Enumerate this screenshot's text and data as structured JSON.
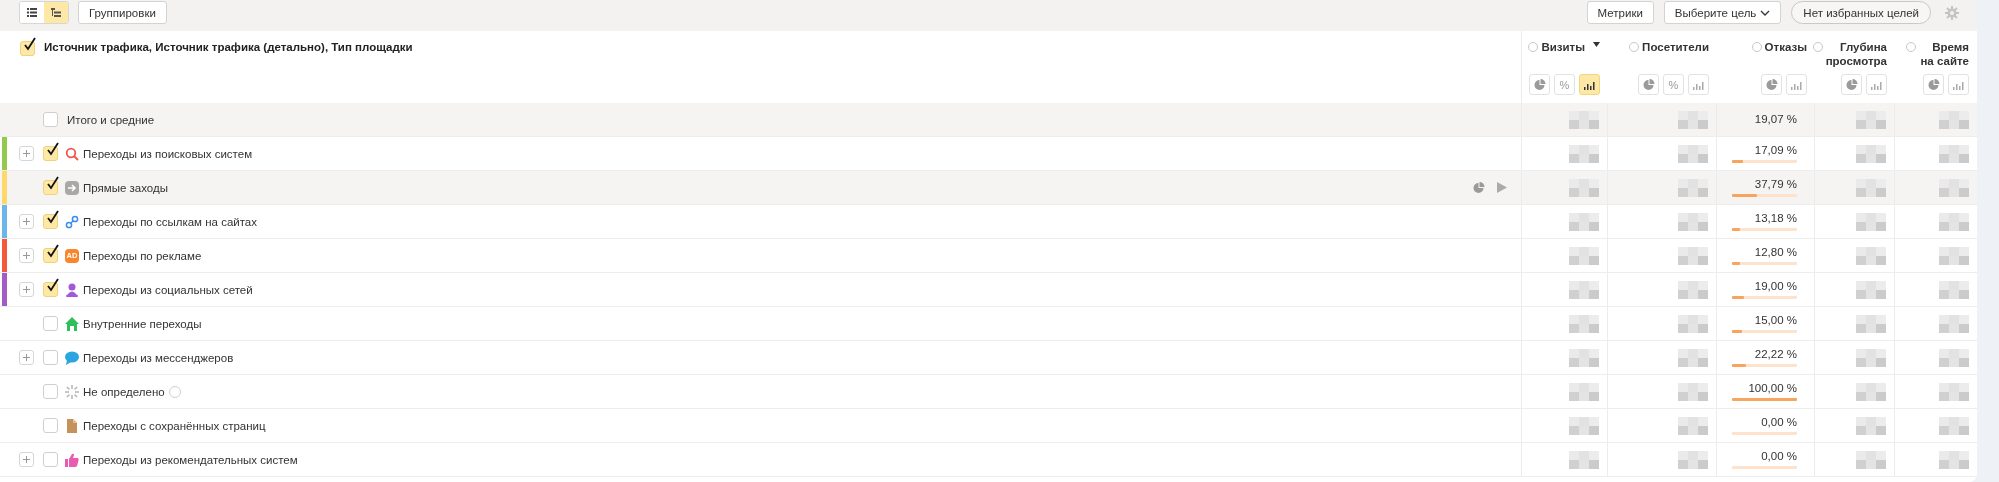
{
  "toolbar": {
    "view_buttons": [
      {
        "kind": "list",
        "selected": false
      },
      {
        "kind": "tree",
        "selected": true
      }
    ],
    "groupings_button": "Группировки",
    "metrics_button": "Метрики",
    "goal_select": "Выберите цель",
    "favorites_button": "Нет избранных целей"
  },
  "table": {
    "dimension_header": {
      "label": "Источник трафика, Источник трафика (детально), Тип площадки",
      "checked": true
    },
    "columns": [
      {
        "name": "Визиты",
        "sorted": true,
        "buttons": [
          {
            "kind": "pie",
            "selected": false
          },
          {
            "kind": "percent",
            "label": "%",
            "selected": false
          },
          {
            "kind": "bars",
            "selected": true
          }
        ]
      },
      {
        "name": "Посетители",
        "sorted": false,
        "buttons": [
          {
            "kind": "pie",
            "selected": false
          },
          {
            "kind": "percent",
            "label": "%",
            "selected": false
          },
          {
            "kind": "bars",
            "selected": false
          }
        ]
      },
      {
        "name": "Отказы",
        "sorted": false,
        "buttons": [
          {
            "kind": "pie",
            "selected": false
          },
          {
            "kind": "bars",
            "selected": false
          }
        ]
      },
      {
        "name": "Глубина просмотра",
        "sorted": false,
        "buttons": [
          {
            "kind": "pie",
            "selected": false
          },
          {
            "kind": "bars",
            "selected": false
          }
        ]
      },
      {
        "name": "Время на сайте",
        "sorted": false,
        "buttons": [
          {
            "kind": "pie",
            "selected": false
          },
          {
            "kind": "bars",
            "selected": false
          }
        ]
      }
    ],
    "rows": [
      {
        "kind": "total",
        "label": "Итого и средние",
        "checked": false,
        "bounce": "19,07 %"
      },
      {
        "kind": "search",
        "label": "Переходы из поисковых систем",
        "expandable": true,
        "checked": true,
        "color": "#93c94f",
        "hovered": false,
        "bounce": "17,09 %",
        "level": 0.17
      },
      {
        "kind": "direct",
        "label": "Прямые заходы",
        "expandable": false,
        "checked": true,
        "color": "#ffd86b",
        "hovered": true,
        "bounce": "37,79 %",
        "level": 0.38
      },
      {
        "kind": "link",
        "label": "Переходы по ссылкам на сайтах",
        "expandable": true,
        "checked": true,
        "color": "#6db6e9",
        "hovered": false,
        "bounce": "13,18 %",
        "level": 0.13
      },
      {
        "kind": "ad",
        "badge": "AD",
        "label": "Переходы по рекламе",
        "expandable": true,
        "checked": true,
        "color": "#f4593b",
        "hovered": false,
        "bounce": "12,80 %",
        "level": 0.13
      },
      {
        "kind": "social",
        "label": "Переходы из социальных сетей",
        "expandable": true,
        "checked": true,
        "color": "#a55bc6",
        "hovered": false,
        "bounce": "19,00 %",
        "level": 0.19
      },
      {
        "kind": "home",
        "label": "Внутренние переходы",
        "expandable": false,
        "checked": false,
        "hovered": false,
        "bounce": "15,00 %",
        "level": 0.15
      },
      {
        "kind": "chat",
        "label": "Переходы из мессенджеров",
        "expandable": true,
        "checked": false,
        "hovered": false,
        "bounce": "22,22 %",
        "level": 0.22
      },
      {
        "kind": "spinner",
        "label": "Не определено",
        "help": true,
        "expandable": false,
        "checked": false,
        "hovered": false,
        "bounce": "100,00 %",
        "level": 1
      },
      {
        "kind": "document",
        "label": "Переходы с сохранённых страниц",
        "expandable": false,
        "checked": false,
        "hovered": false,
        "bounce": "0,00 %",
        "level": 0
      },
      {
        "kind": "thumb",
        "label": "Переходы из рекомендательных систем",
        "expandable": true,
        "checked": false,
        "hovered": false,
        "bounce": "0,00 %",
        "level": 0
      }
    ]
  }
}
